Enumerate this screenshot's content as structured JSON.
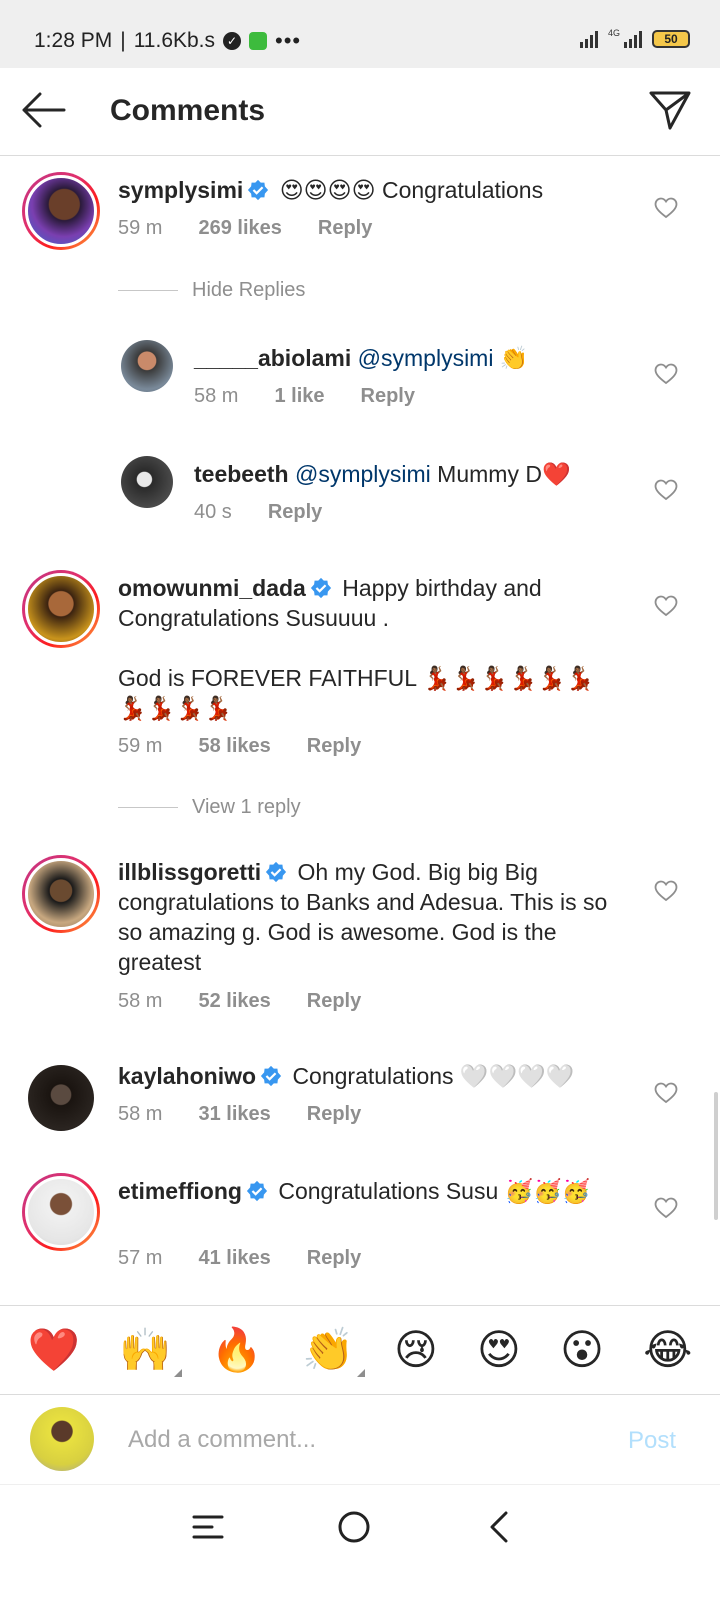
{
  "status_bar": {
    "time": "1:28 PM",
    "separator": "|",
    "speed": "11.6Kb.s",
    "more": "•••",
    "network": "4G",
    "battery": "50"
  },
  "header": {
    "title": "Comments"
  },
  "comments": [
    {
      "username": "symplysimi",
      "verified": true,
      "text": "😍😍😍😍 Congratulations",
      "time": "59 m",
      "likes": "269 likes",
      "reply": "Reply",
      "thread_toggle": "Hide Replies"
    },
    {
      "username": "_____abiolami",
      "mention": "@symplysimi",
      "text": "👏",
      "time": "58 m",
      "likes": "1 like",
      "reply": "Reply"
    },
    {
      "username": "teebeeth",
      "mention": "@symplysimi",
      "text": "Mummy D❤️",
      "time": "40 s",
      "reply": "Reply"
    },
    {
      "username": "omowunmi_dada",
      "verified": true,
      "text": "Happy birthday and Congratulations Susuuuu .",
      "text2": "God is FOREVER FAITHFUL 💃🏾💃🏾💃🏾💃🏾💃🏾💃🏾💃🏾💃🏾💃🏾💃🏾",
      "time": "59 m",
      "likes": "58 likes",
      "reply": "Reply",
      "thread_toggle": "View 1 reply"
    },
    {
      "username": "illblissgoretti",
      "verified": true,
      "text": "Oh my God. Big big Big congratulations to Banks and Adesua. This is so so amazing g. God is awesome. God is the greatest",
      "time": "58 m",
      "likes": "52 likes",
      "reply": "Reply"
    },
    {
      "username": "kaylahoniwo",
      "verified": true,
      "text": "Congratulations 🤍🤍🤍🤍",
      "time": "58 m",
      "likes": "31 likes",
      "reply": "Reply"
    },
    {
      "username": "etimeffiong",
      "verified": true,
      "text": "Congratulations Susu 🥳🥳🥳",
      "time": "57 m",
      "likes": "41 likes",
      "reply": "Reply"
    }
  ],
  "reactions": [
    "❤️",
    "🙌",
    "🔥",
    "👏",
    "😢",
    "😍",
    "😮",
    "😂"
  ],
  "composer": {
    "placeholder": "Add a comment...",
    "post": "Post"
  },
  "colors": {
    "mention": "#00376b",
    "post_disabled": "#b2dffc",
    "verified": "#3897f0"
  }
}
